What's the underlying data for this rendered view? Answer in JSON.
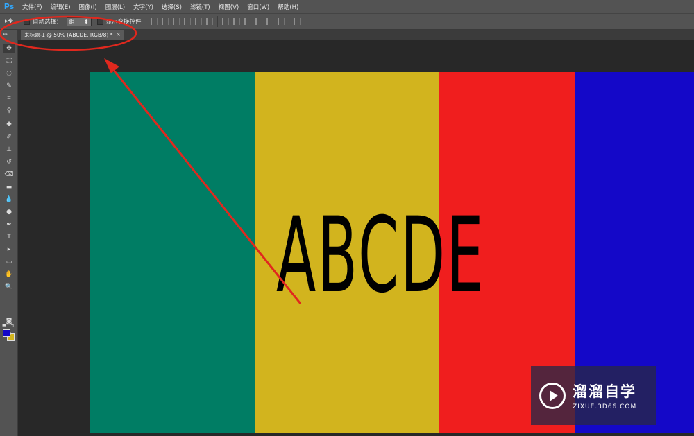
{
  "app": {
    "logo": "Ps"
  },
  "menu": [
    "文件(F)",
    "编辑(E)",
    "图像(I)",
    "图层(L)",
    "文字(Y)",
    "选择(S)",
    "滤镜(T)",
    "视图(V)",
    "窗口(W)",
    "帮助(H)"
  ],
  "options": {
    "tool_icon": "move-tool-icon",
    "auto_select_label": "自动选择：",
    "auto_select_value": "组",
    "show_transform_label": "显示变换控件"
  },
  "document_tab": {
    "title": "未标题-1 @ 50% (ABCDE, RGB/8) *",
    "close": "×"
  },
  "colors": {
    "foreground": "#1408c8",
    "background": "#d2b41e",
    "annotation": "#e0281e"
  },
  "canvas": {
    "text": "ABCDE",
    "stripes": [
      {
        "name": "green",
        "color": "#007d64"
      },
      {
        "name": "yellow",
        "color": "#d2b41e"
      },
      {
        "name": "red",
        "color": "#f01e1e"
      },
      {
        "name": "blue",
        "color": "#1408c8"
      }
    ]
  },
  "watermark": {
    "brand": "溜溜自学",
    "url": "ZIXUE.3D66.COM"
  }
}
